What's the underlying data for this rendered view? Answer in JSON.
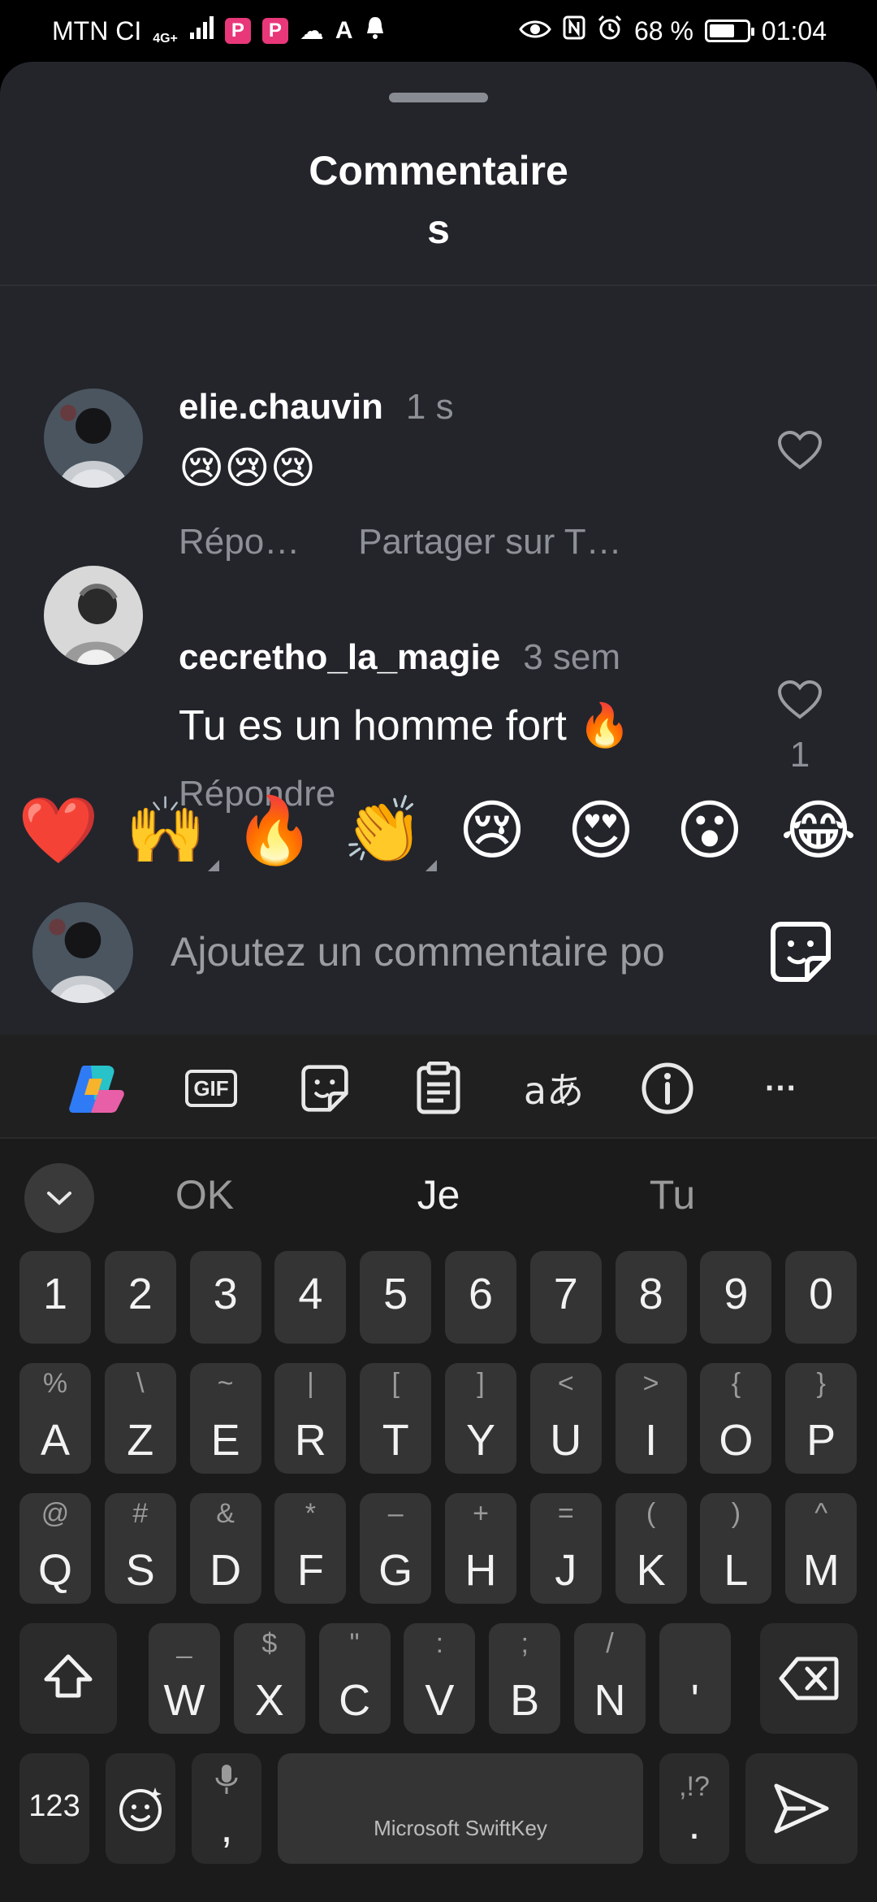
{
  "status_bar": {
    "carrier": "MTN CI",
    "network": "4G+",
    "battery": "68 %",
    "battery_level": 0.68,
    "time": "01:04"
  },
  "sheet": {
    "title_line1": "Commentaire",
    "title_line2": "s"
  },
  "comments": [
    {
      "username": "elie.chauvin",
      "time": "1 s",
      "body": "😢😢😢",
      "reply_label": "Répo…",
      "share_label": "Partager sur T…",
      "likes": ""
    },
    {
      "username": "cecretho_la_magie",
      "time": "3 sem",
      "body": "Tu es un homme fort 🔥",
      "reply_label": "Répondre",
      "likes": "1"
    }
  ],
  "reactions": [
    "❤️",
    "🙌",
    "🔥",
    "👏",
    "😢",
    "😍",
    "😮",
    "😂"
  ],
  "composer": {
    "placeholder": "Ajoutez un commentaire po"
  },
  "keyboard": {
    "toolbar": [
      "copilot-icon",
      "gif-icon",
      "sticker-icon",
      "clipboard-icon",
      "translate-icon",
      "info-icon",
      "more-icon"
    ],
    "gif_label": "GIF",
    "translate_label": "aあ",
    "more_label": "···",
    "suggestions": [
      "OK",
      "Je",
      "Tu"
    ],
    "number_row": [
      "1",
      "2",
      "3",
      "4",
      "5",
      "6",
      "7",
      "8",
      "9",
      "0"
    ],
    "row1": [
      {
        "key": "A",
        "sec": "%"
      },
      {
        "key": "Z",
        "sec": "\\"
      },
      {
        "key": "E",
        "sec": "~"
      },
      {
        "key": "R",
        "sec": "|"
      },
      {
        "key": "T",
        "sec": "["
      },
      {
        "key": "Y",
        "sec": "]"
      },
      {
        "key": "U",
        "sec": "<"
      },
      {
        "key": "I",
        "sec": ">"
      },
      {
        "key": "O",
        "sec": "{"
      },
      {
        "key": "P",
        "sec": "}"
      }
    ],
    "row2": [
      {
        "key": "Q",
        "sec": "@"
      },
      {
        "key": "S",
        "sec": "#"
      },
      {
        "key": "D",
        "sec": "&"
      },
      {
        "key": "F",
        "sec": "*"
      },
      {
        "key": "G",
        "sec": "–"
      },
      {
        "key": "H",
        "sec": "+"
      },
      {
        "key": "J",
        "sec": "="
      },
      {
        "key": "K",
        "sec": "("
      },
      {
        "key": "L",
        "sec": ")"
      },
      {
        "key": "M",
        "sec": "^"
      }
    ],
    "row3": [
      {
        "key": "W",
        "sec": "_"
      },
      {
        "key": "X",
        "sec": "$"
      },
      {
        "key": "C",
        "sec": "\""
      },
      {
        "key": "V",
        "sec": ":"
      },
      {
        "key": "B",
        "sec": ";"
      },
      {
        "key": "N",
        "sec": "/"
      },
      {
        "key": "'",
        "sec": ""
      }
    ],
    "numbers_key": "123",
    "comma_key": ",",
    "space_label": "Microsoft SwiftKey",
    "period_key": ".",
    "period_sec": ",!?"
  },
  "colors": {
    "sheet_bg": "#23252b",
    "keyboard_bg": "#1b1b1b",
    "key_bg": "#343434",
    "muted_text": "#8e9097"
  }
}
